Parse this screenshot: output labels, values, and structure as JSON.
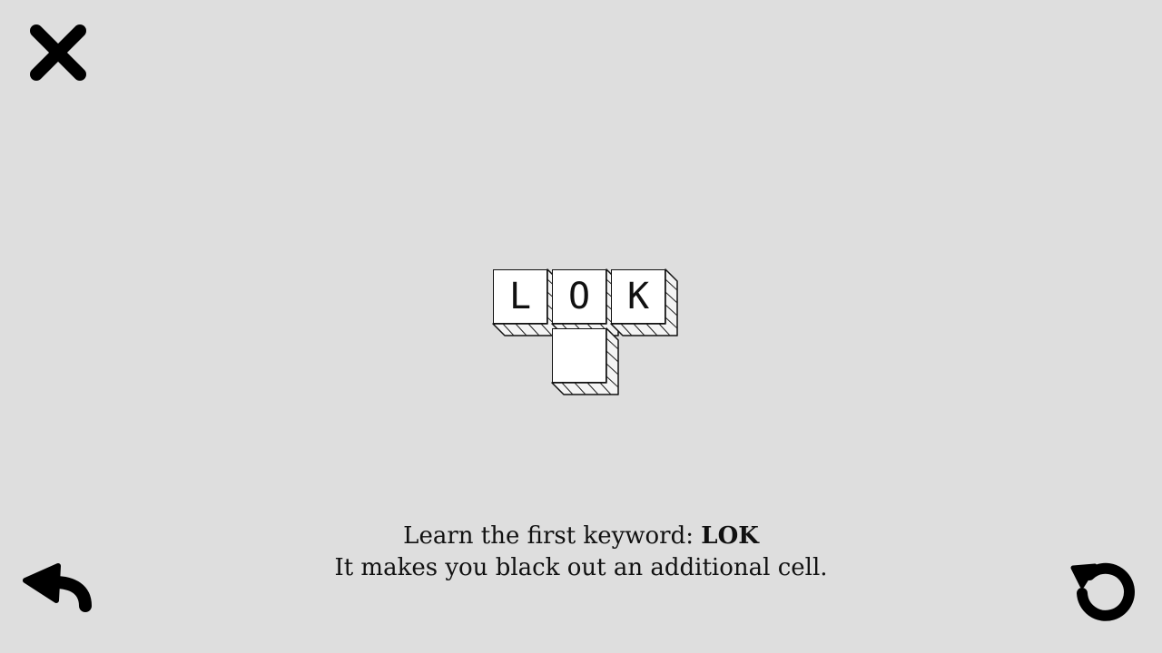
{
  "controls": {
    "close": {
      "icon": "close-icon"
    },
    "undo": {
      "icon": "undo-icon"
    },
    "restart": {
      "icon": "restart-icon"
    }
  },
  "board": {
    "cells": [
      {
        "letter": "L",
        "col": 0,
        "row": 0
      },
      {
        "letter": "O",
        "col": 1,
        "row": 0
      },
      {
        "letter": "K",
        "col": 2,
        "row": 0
      },
      {
        "letter": "",
        "col": 1,
        "row": 1
      }
    ]
  },
  "caption": {
    "line1_prefix": "Learn the first keyword: ",
    "keyword": "LOK",
    "line2": "It makes you black out an additional cell."
  },
  "colors": {
    "background": "#dedede",
    "ink": "#111111",
    "cell_face": "#ffffff"
  }
}
